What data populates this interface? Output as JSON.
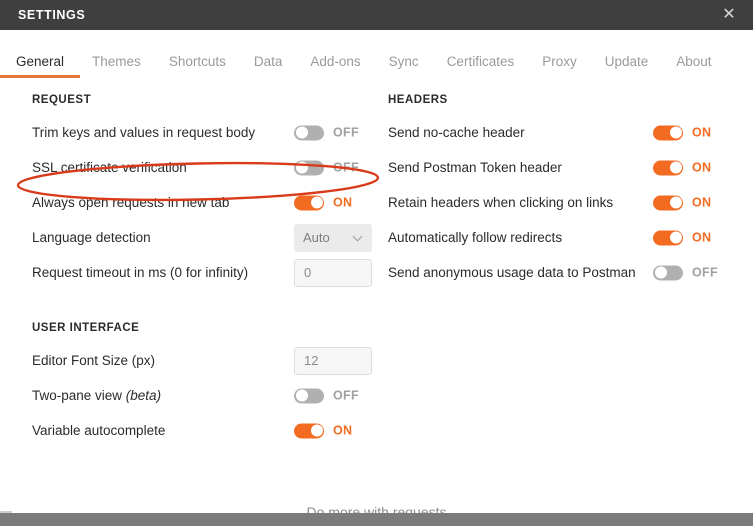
{
  "window": {
    "title": "SETTINGS",
    "close_icon": "close-icon",
    "titlebar_color": "#3f3f3f"
  },
  "accent_color": "#f26b21",
  "tabs": [
    {
      "label": "General",
      "active": true
    },
    {
      "label": "Themes",
      "active": false
    },
    {
      "label": "Shortcuts",
      "active": false
    },
    {
      "label": "Data",
      "active": false
    },
    {
      "label": "Add-ons",
      "active": false
    },
    {
      "label": "Sync",
      "active": false
    },
    {
      "label": "Certificates",
      "active": false
    },
    {
      "label": "Proxy",
      "active": false
    },
    {
      "label": "Update",
      "active": false
    },
    {
      "label": "About",
      "active": false
    }
  ],
  "left_column": {
    "sections": [
      {
        "title": "REQUEST",
        "rows": [
          {
            "label": "Trim keys and values in request body",
            "control": "toggle",
            "state": "OFF"
          },
          {
            "label": "SSL certificate verification",
            "control": "toggle",
            "state": "OFF",
            "highlighted": true
          },
          {
            "label": "Always open requests in new tab",
            "control": "toggle",
            "state": "ON"
          },
          {
            "label": "Language detection",
            "control": "select",
            "value": "Auto",
            "chevron": "chevron-down-icon"
          },
          {
            "label": "Request timeout in ms (0 for infinity)",
            "control": "input",
            "value": "0"
          }
        ]
      },
      {
        "title": "USER INTERFACE",
        "rows": [
          {
            "label": "Editor Font Size (px)",
            "control": "input",
            "value": "12"
          },
          {
            "label": "Two-pane view ",
            "label_italic": "(beta)",
            "control": "toggle",
            "state": "OFF"
          },
          {
            "label": "Variable autocomplete",
            "control": "toggle",
            "state": "ON"
          }
        ]
      }
    ]
  },
  "right_column": {
    "sections": [
      {
        "title": "HEADERS",
        "rows": [
          {
            "label": "Send no-cache header",
            "control": "toggle",
            "state": "ON"
          },
          {
            "label": "Send Postman Token header",
            "control": "toggle",
            "state": "ON"
          },
          {
            "label": "Retain headers when clicking on links",
            "control": "toggle",
            "state": "ON"
          },
          {
            "label": "Automatically follow redirects",
            "control": "toggle",
            "state": "ON"
          },
          {
            "label": "Send anonymous usage data to Postman",
            "control": "toggle",
            "state": "OFF"
          }
        ]
      }
    ]
  },
  "annotation": {
    "shape": "ellipse",
    "color": "#d93a1a",
    "target": "SSL certificate verification"
  },
  "background": {
    "heading": "Do more with requests"
  }
}
